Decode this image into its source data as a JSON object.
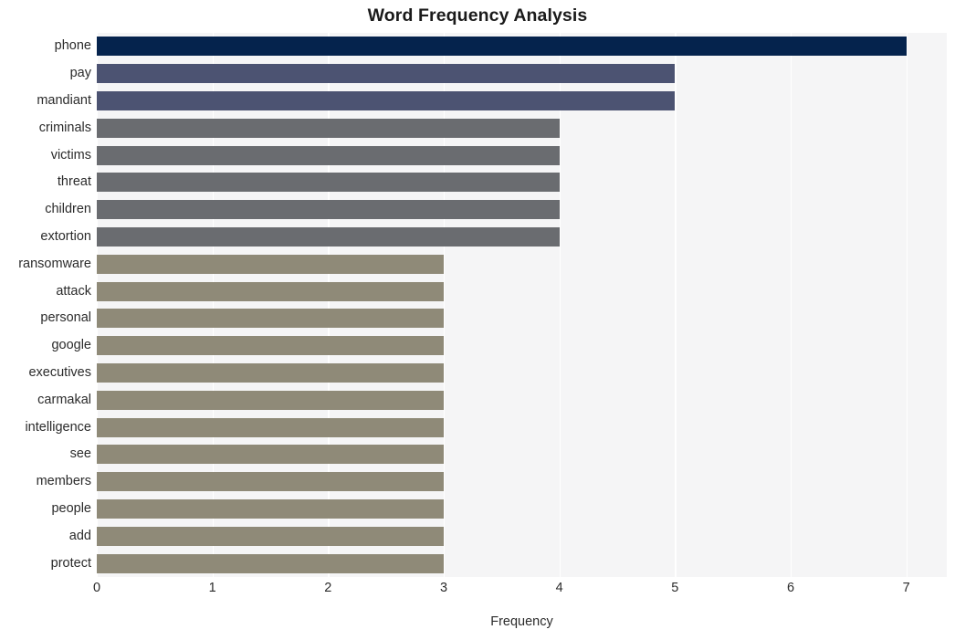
{
  "chart_data": {
    "type": "bar",
    "orientation": "horizontal",
    "title": "Word Frequency Analysis",
    "xlabel": "Frequency",
    "ylabel": "",
    "xlim": [
      0,
      7.35
    ],
    "xticks": [
      0,
      1,
      2,
      3,
      4,
      5,
      6,
      7
    ],
    "xtick_labels": [
      "0",
      "1",
      "2",
      "3",
      "4",
      "5",
      "6",
      "7"
    ],
    "grid": "vertical-white-on-light",
    "legend": "none",
    "categories": [
      "phone",
      "pay",
      "mandiant",
      "criminals",
      "victims",
      "threat",
      "children",
      "extortion",
      "ransomware",
      "attack",
      "personal",
      "google",
      "executives",
      "carmakal",
      "intelligence",
      "see",
      "members",
      "people",
      "add",
      "protect"
    ],
    "values": [
      7,
      5,
      5,
      4,
      4,
      4,
      4,
      4,
      3,
      3,
      3,
      3,
      3,
      3,
      3,
      3,
      3,
      3,
      3,
      3
    ],
    "bar_colors": [
      "#05234d",
      "#4c5372",
      "#4c5372",
      "#6a6c70",
      "#6a6c70",
      "#6a6c70",
      "#6a6c70",
      "#6a6c70",
      "#8f8a78",
      "#8f8a78",
      "#8f8a78",
      "#8f8a78",
      "#8f8a78",
      "#8f8a78",
      "#8f8a78",
      "#8f8a78",
      "#8f8a78",
      "#8f8a78",
      "#8f8a78",
      "#8f8a78"
    ],
    "palette": {
      "rank1": "#05234d",
      "rank2": "#4c5372",
      "rank3": "#6a6c70",
      "rank4": "#8f8a78"
    },
    "plot_background": "#f5f5f6",
    "figure_background": "#ffffff",
    "gridline_color": "#ffffff",
    "text_color": "#2b2b2b"
  }
}
